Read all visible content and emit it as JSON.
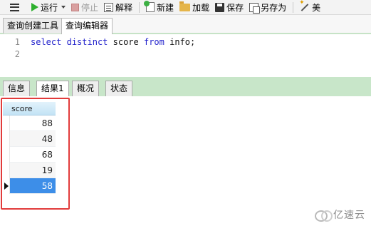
{
  "toolbar": {
    "menu_icon": "hamburger-icon",
    "run_label": "运行",
    "stop_label": "停止",
    "explain_label": "解释",
    "new_label": "新建",
    "load_label": "加载",
    "save_label": "保存",
    "saveas_label": "另存为",
    "beautify_label": "美",
    "icons": {
      "run": "play-icon",
      "stop": "stop-icon",
      "explain": "explain-icon",
      "new": "new-file-icon",
      "load": "folder-icon",
      "save": "save-icon",
      "saveas": "save-as-icon",
      "beautify": "magic-wand-icon"
    }
  },
  "editor_tabs": [
    {
      "label": "查询创建工具",
      "active": false
    },
    {
      "label": "查询编辑器",
      "active": true
    }
  ],
  "editor": {
    "line_numbers": [
      "1",
      "2"
    ],
    "code": {
      "kw_select": "select",
      "kw_distinct": "distinct",
      "col": "score",
      "kw_from": "from",
      "table": "info;"
    }
  },
  "result_tabs": [
    {
      "label": "信息",
      "active": false
    },
    {
      "label": "结果1",
      "active": true
    },
    {
      "label": "概况",
      "active": false
    },
    {
      "label": "状态",
      "active": false
    }
  ],
  "results": {
    "column": "score",
    "rows": [
      "88",
      "48",
      "68",
      "19",
      "58"
    ],
    "selected_row": 4
  },
  "watermark": {
    "text": "亿速云",
    "logo_icon": "yisu-cloud-logo"
  },
  "colors": {
    "keyword": "#2222cc",
    "result_tab_bar": "#c8e6c9",
    "selected_row": "#3d8ee8",
    "highlight_box": "#e23b3b"
  }
}
